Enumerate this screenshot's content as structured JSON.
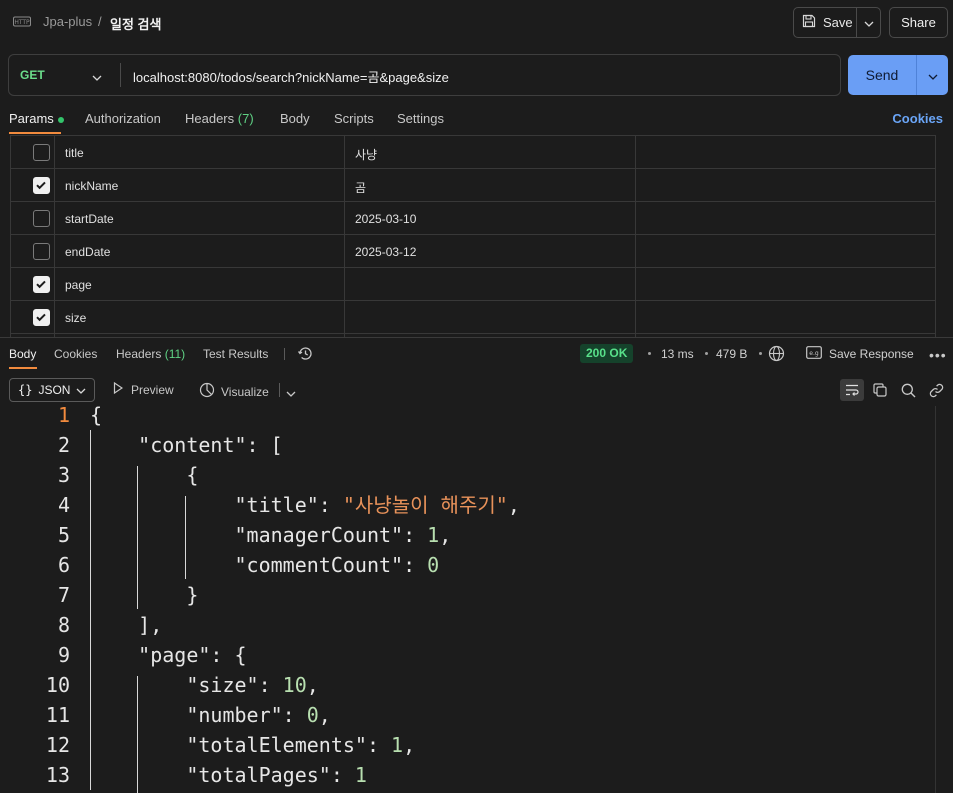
{
  "breadcrumb": {
    "parent": "Jpa-plus",
    "separator": "/",
    "title": "일정 검색"
  },
  "toolbar": {
    "save_label": "Save",
    "share_label": "Share"
  },
  "request": {
    "method": "GET",
    "url": "localhost:8080/todos/search?nickName=곰&page&size",
    "send_label": "Send"
  },
  "request_tabs": {
    "params": "Params",
    "authorization": "Authorization",
    "headers": "Headers",
    "headers_count": "(7)",
    "body": "Body",
    "scripts": "Scripts",
    "settings": "Settings",
    "cookies": "Cookies"
  },
  "params": [
    {
      "key": "title",
      "value": "사냥",
      "checked": false
    },
    {
      "key": "nickName",
      "value": "곰",
      "checked": true
    },
    {
      "key": "startDate",
      "value": "2025-03-10",
      "checked": false
    },
    {
      "key": "endDate",
      "value": "2025-03-12",
      "checked": false
    },
    {
      "key": "page",
      "value": "",
      "checked": true
    },
    {
      "key": "size",
      "value": "",
      "checked": true
    }
  ],
  "response_tabs": {
    "body": "Body",
    "cookies": "Cookies",
    "headers": "Headers",
    "headers_count": "(11)",
    "test_results": "Test Results"
  },
  "response_meta": {
    "status": "200 OK",
    "time": "13 ms",
    "size": "479 B",
    "save_response": "Save Response"
  },
  "response_toolbar": {
    "format": "JSON",
    "format_braces": "{}",
    "preview": "Preview",
    "visualize": "Visualize"
  },
  "code_lines": [
    {
      "n": "1",
      "text": "{"
    },
    {
      "n": "2",
      "text": "    \"content\": ["
    },
    {
      "n": "3",
      "text": "        {"
    },
    {
      "n": "4",
      "text": "            \"title\": \"사냥놀이 해주기\","
    },
    {
      "n": "5",
      "text": "            \"managerCount\": 1,"
    },
    {
      "n": "6",
      "text": "            \"commentCount\": 0"
    },
    {
      "n": "7",
      "text": "        }"
    },
    {
      "n": "8",
      "text": "    ],"
    },
    {
      "n": "9",
      "text": "    \"page\": {"
    },
    {
      "n": "10",
      "text": "        \"size\": 10,"
    },
    {
      "n": "11",
      "text": "        \"number\": 0,"
    },
    {
      "n": "12",
      "text": "        \"totalElements\": 1,"
    },
    {
      "n": "13",
      "text": "        \"totalPages\": 1"
    }
  ],
  "colors": {
    "method": "#6bdd8b",
    "send": "#6a9ef5",
    "accent_underline": "#f28b3e",
    "status_ok": "#58e08a",
    "json_string_value": "#e8925a",
    "json_number": "#b8dfb0"
  },
  "icons": [
    "http-icon",
    "save-icon",
    "chevron-down-icon",
    "history-icon",
    "globe-icon",
    "save-response-icon",
    "more-icon",
    "play-icon",
    "visualize-icon",
    "wrap-icon",
    "copy-icon",
    "search-icon",
    "link-icon"
  ]
}
